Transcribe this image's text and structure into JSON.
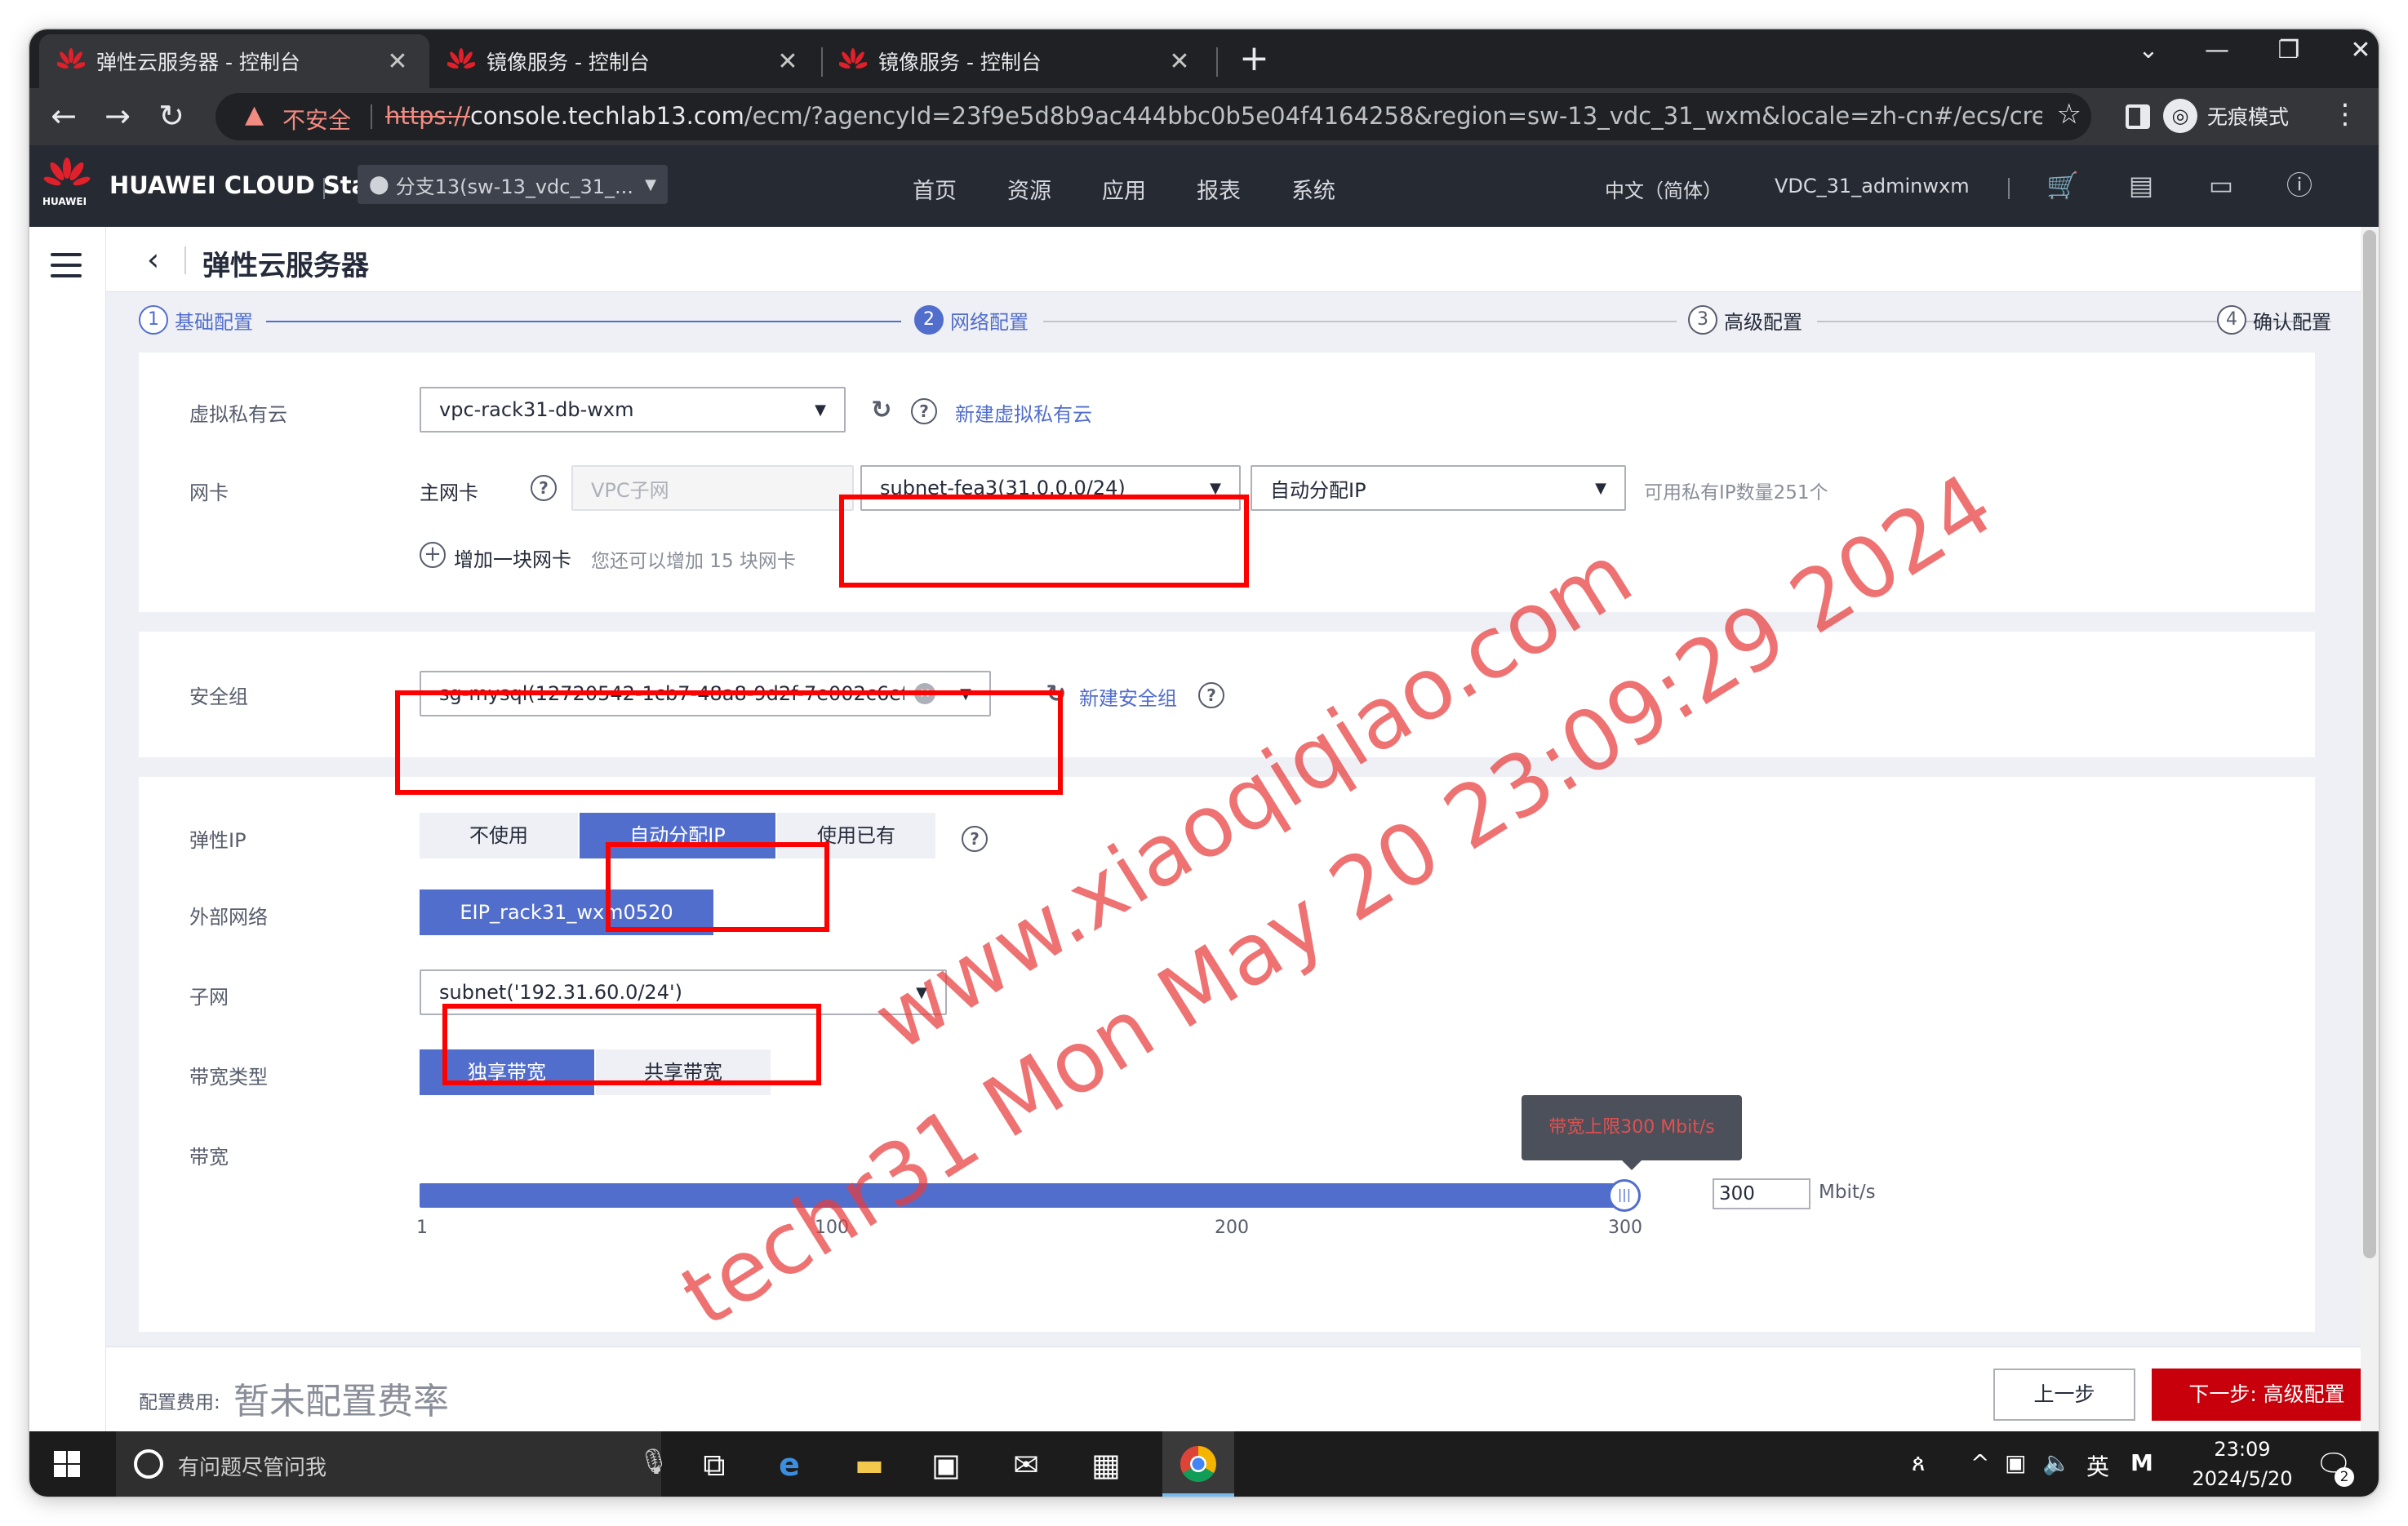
{
  "browser": {
    "tabs": [
      {
        "title": "弹性云服务器 - 控制台",
        "active": true
      },
      {
        "title": "镜像服务 - 控制台",
        "active": false
      },
      {
        "title": "镜像服务 - 控制台",
        "active": false
      }
    ],
    "insecure_label": "不安全",
    "url_scheme": "https://",
    "url_host": "console.techlab13.com",
    "url_path": "/ecm/?agencyId=23f9e5d8b9ac444bbc0b5e04f4164258&region=sw-13_vdc_31_wxm&locale=zh-cn#/ecs/createVm?prod...",
    "incognito_label": "无痕模式"
  },
  "header": {
    "logo_text": "HUAWEI CLOUD Stack",
    "logo_sub": "HUAWEI",
    "region": "分支13(sw-13_vdc_31_...",
    "nav": [
      "首页",
      "资源",
      "应用",
      "报表",
      "系统"
    ],
    "language": "中文（简体）",
    "user": "VDC_31_adminwxm"
  },
  "page": {
    "title": "弹性云服务器"
  },
  "steps": [
    {
      "num": "1",
      "label": "基础配置",
      "state": "done"
    },
    {
      "num": "2",
      "label": "网络配置",
      "state": "current"
    },
    {
      "num": "3",
      "label": "高级配置",
      "state": "todo"
    },
    {
      "num": "4",
      "label": "确认配置",
      "state": "todo"
    }
  ],
  "network": {
    "vpc_label": "虚拟私有云",
    "vpc_value": "vpc-rack31-db-wxm",
    "new_vpc_link": "新建虚拟私有云",
    "nic_label": "网卡",
    "primary_nic_label": "主网卡",
    "vpc_subnet_placeholder": "VPC子网",
    "subnet_value": "subnet-fea3(31.0.0.0/24)",
    "ip_mode": "自动分配IP",
    "available_ip_hint": "可用私有IP数量251个",
    "add_nic_label": "增加一块网卡",
    "add_nic_hint": "您还可以增加 15 块网卡"
  },
  "security": {
    "label": "安全组",
    "value": "sg-mysql(12720542-1cb7-48a8-9d2f-7e002c6ef...",
    "new_link": "新建安全组"
  },
  "eip": {
    "label": "弹性IP",
    "options": [
      "不使用",
      "自动分配IP",
      "使用已有"
    ],
    "selected": "自动分配IP",
    "external_network_label": "外部网络",
    "external_network_value": "EIP_rack31_wxm0520",
    "subnet_label": "子网",
    "subnet_value": "subnet('192.31.60.0/24')",
    "bandwidth_type_label": "带宽类型",
    "bandwidth_types": [
      "独享带宽",
      "共享带宽"
    ],
    "bandwidth_type_selected": "独享带宽",
    "bandwidth_label": "带宽",
    "tooltip": "带宽上限300 Mbit/s",
    "bandwidth_fill": 1.0,
    "ticks": [
      "1",
      "100",
      "200",
      "300"
    ],
    "bandwidth_value": "300",
    "unit": "Mbit/s"
  },
  "footer": {
    "fee_label": "配置费用:",
    "fee_value": "暂未配置费率",
    "prev_button": "上一步",
    "next_button": "下一步: 高级配置"
  },
  "watermark": {
    "line1": "www.xiaoqiqiao.com",
    "line2": "techr31 Mon May 20 23:09:29 2024"
  },
  "taskbar": {
    "search_placeholder": "有问题尽管问我",
    "ime": "英",
    "time": "23:09",
    "date": "2024/5/20",
    "notification_count": "2"
  },
  "colors": {
    "accent": "#526ecc",
    "primary_button": "#c7000b",
    "highlight_box": "#ff0000",
    "header_bg": "#262a33"
  }
}
